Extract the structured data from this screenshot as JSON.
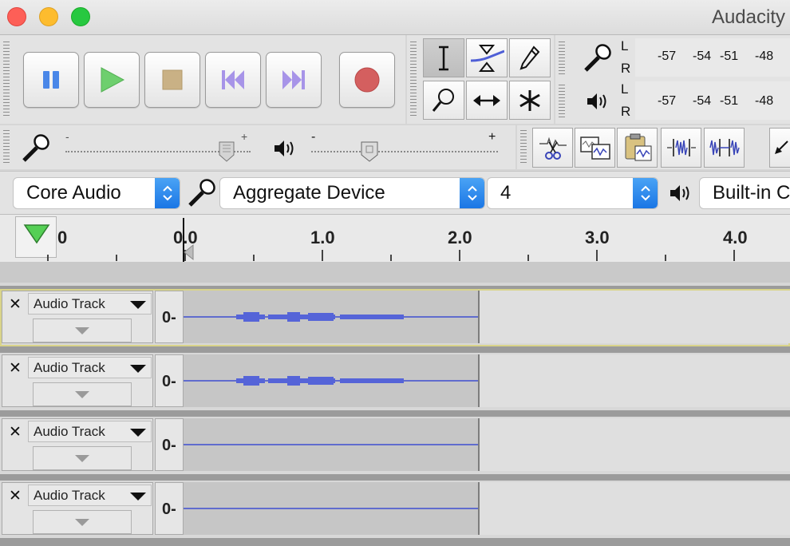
{
  "window": {
    "title": "Audacity"
  },
  "meters": {
    "recording": {
      "channels": [
        "L",
        "R"
      ],
      "ticks": [
        "-57",
        "-54",
        "-51",
        "-48"
      ]
    },
    "playback": {
      "channels": [
        "L",
        "R"
      ],
      "ticks": [
        "-57",
        "-54",
        "-51",
        "-48"
      ]
    }
  },
  "mixer": {
    "input_level": 0.87,
    "output_level": 0.31,
    "output_min_label": "-",
    "output_max_label": "+",
    "input_max_label": "+",
    "input_min_label": "-"
  },
  "device": {
    "host": "Core Audio",
    "input_device": "Aggregate Device",
    "channels": "4",
    "output_device": "Built-in C"
  },
  "ruler": {
    "labels": [
      "0",
      "0.0",
      "1.0",
      "2.0",
      "3.0",
      "4.0"
    ]
  },
  "tracks": [
    {
      "name": "Audio Track",
      "zero_label": "0-",
      "has_audio": true,
      "selected": true
    },
    {
      "name": "Audio Track",
      "zero_label": "0-",
      "has_audio": true,
      "selected": false
    },
    {
      "name": "Audio Track",
      "zero_label": "0-",
      "has_audio": false,
      "selected": false
    },
    {
      "name": "Audio Track",
      "zero_label": "0-",
      "has_audio": false,
      "selected": false
    }
  ],
  "colors": {
    "waveform": "#3f4fd0",
    "record": "#d45f5f",
    "play": "#6ecf6e",
    "skip": "#a794e8",
    "pause": "#4a87e8"
  }
}
